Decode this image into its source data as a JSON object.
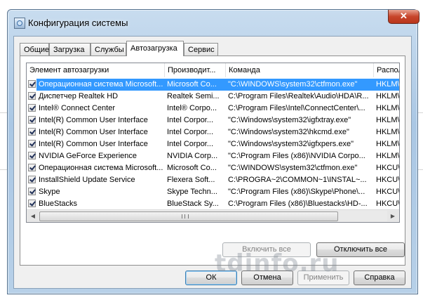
{
  "window": {
    "title": "Конфигурация системы",
    "close_label": "✕"
  },
  "tabs": [
    {
      "label": "Общие"
    },
    {
      "label": "Загрузка"
    },
    {
      "label": "Службы"
    },
    {
      "label": "Автозагрузка"
    },
    {
      "label": "Сервис"
    }
  ],
  "active_tab": "Автозагрузка",
  "startup_list": {
    "columns": [
      "Элемент автозагрузки",
      "Производит...",
      "Команда",
      "Распол"
    ],
    "rows": [
      {
        "checked": true,
        "name": "Операционная система Microsoft...",
        "manufacturer": "Microsoft Co...",
        "command": "\"C:\\WINDOWS\\system32\\ctfmon.exe\"",
        "location": "HKLM\\S",
        "selected": true
      },
      {
        "checked": true,
        "name": "Диспетчер Realtek HD",
        "manufacturer": "Realtek Semi...",
        "command": "C:\\Program Files\\Realtek\\Audio\\HDA\\R...",
        "location": "HKLM\\S"
      },
      {
        "checked": true,
        "name": "Intel® Connect Center",
        "manufacturer": "Intel® Corpo...",
        "command": "C:\\Program Files\\Intel\\ConnectCenter\\...",
        "location": "HKLM\\S"
      },
      {
        "checked": true,
        "name": "Intel(R) Common User Interface",
        "manufacturer": "Intel Corpor...",
        "command": "\"C:\\Windows\\system32\\igfxtray.exe\"",
        "location": "HKLM\\S"
      },
      {
        "checked": true,
        "name": "Intel(R) Common User Interface",
        "manufacturer": "Intel Corpor...",
        "command": "\"C:\\Windows\\system32\\hkcmd.exe\"",
        "location": "HKLM\\S"
      },
      {
        "checked": true,
        "name": "Intel(R) Common User Interface",
        "manufacturer": "Intel Corpor...",
        "command": "\"C:\\Windows\\system32\\igfxpers.exe\"",
        "location": "HKLM\\S"
      },
      {
        "checked": true,
        "name": "NVIDIA GeForce Experience",
        "manufacturer": "NVIDIA Corp...",
        "command": "\"C:\\Program Files (x86)\\NVIDIA Corpo...",
        "location": "HKLM\\S"
      },
      {
        "checked": true,
        "name": "Операционная система Microsoft...",
        "manufacturer": "Microsoft Co...",
        "command": "\"C:\\WINDOWS\\system32\\ctfmon.exe\"",
        "location": "HKCU\\S"
      },
      {
        "checked": true,
        "name": "InstallShield Update Service",
        "manufacturer": "Flexera Soft...",
        "command": "C:\\PROGRA~2\\COMMON~1\\INSTAL~...",
        "location": "HKCU\\S"
      },
      {
        "checked": true,
        "name": "Skype",
        "manufacturer": "Skype Techn...",
        "command": "\"C:\\Program Files (x86)\\Skype\\Phone\\...",
        "location": "HKCU\\S"
      },
      {
        "checked": true,
        "name": "BlueStacks",
        "manufacturer": "BlueStack Sy...",
        "command": "C:\\Program Files (x86)\\Bluestacks\\HD-...",
        "location": "HKCU\\S"
      }
    ]
  },
  "buttons": {
    "enable_all": "Включить все",
    "disable_all": "Отключить все",
    "ok": "ОК",
    "cancel": "Отмена",
    "apply": "Применить",
    "help": "Справка"
  },
  "watermark": "tdinfo.ru",
  "colors": {
    "selection": "#3399ff",
    "frame": "#aac7e4"
  }
}
